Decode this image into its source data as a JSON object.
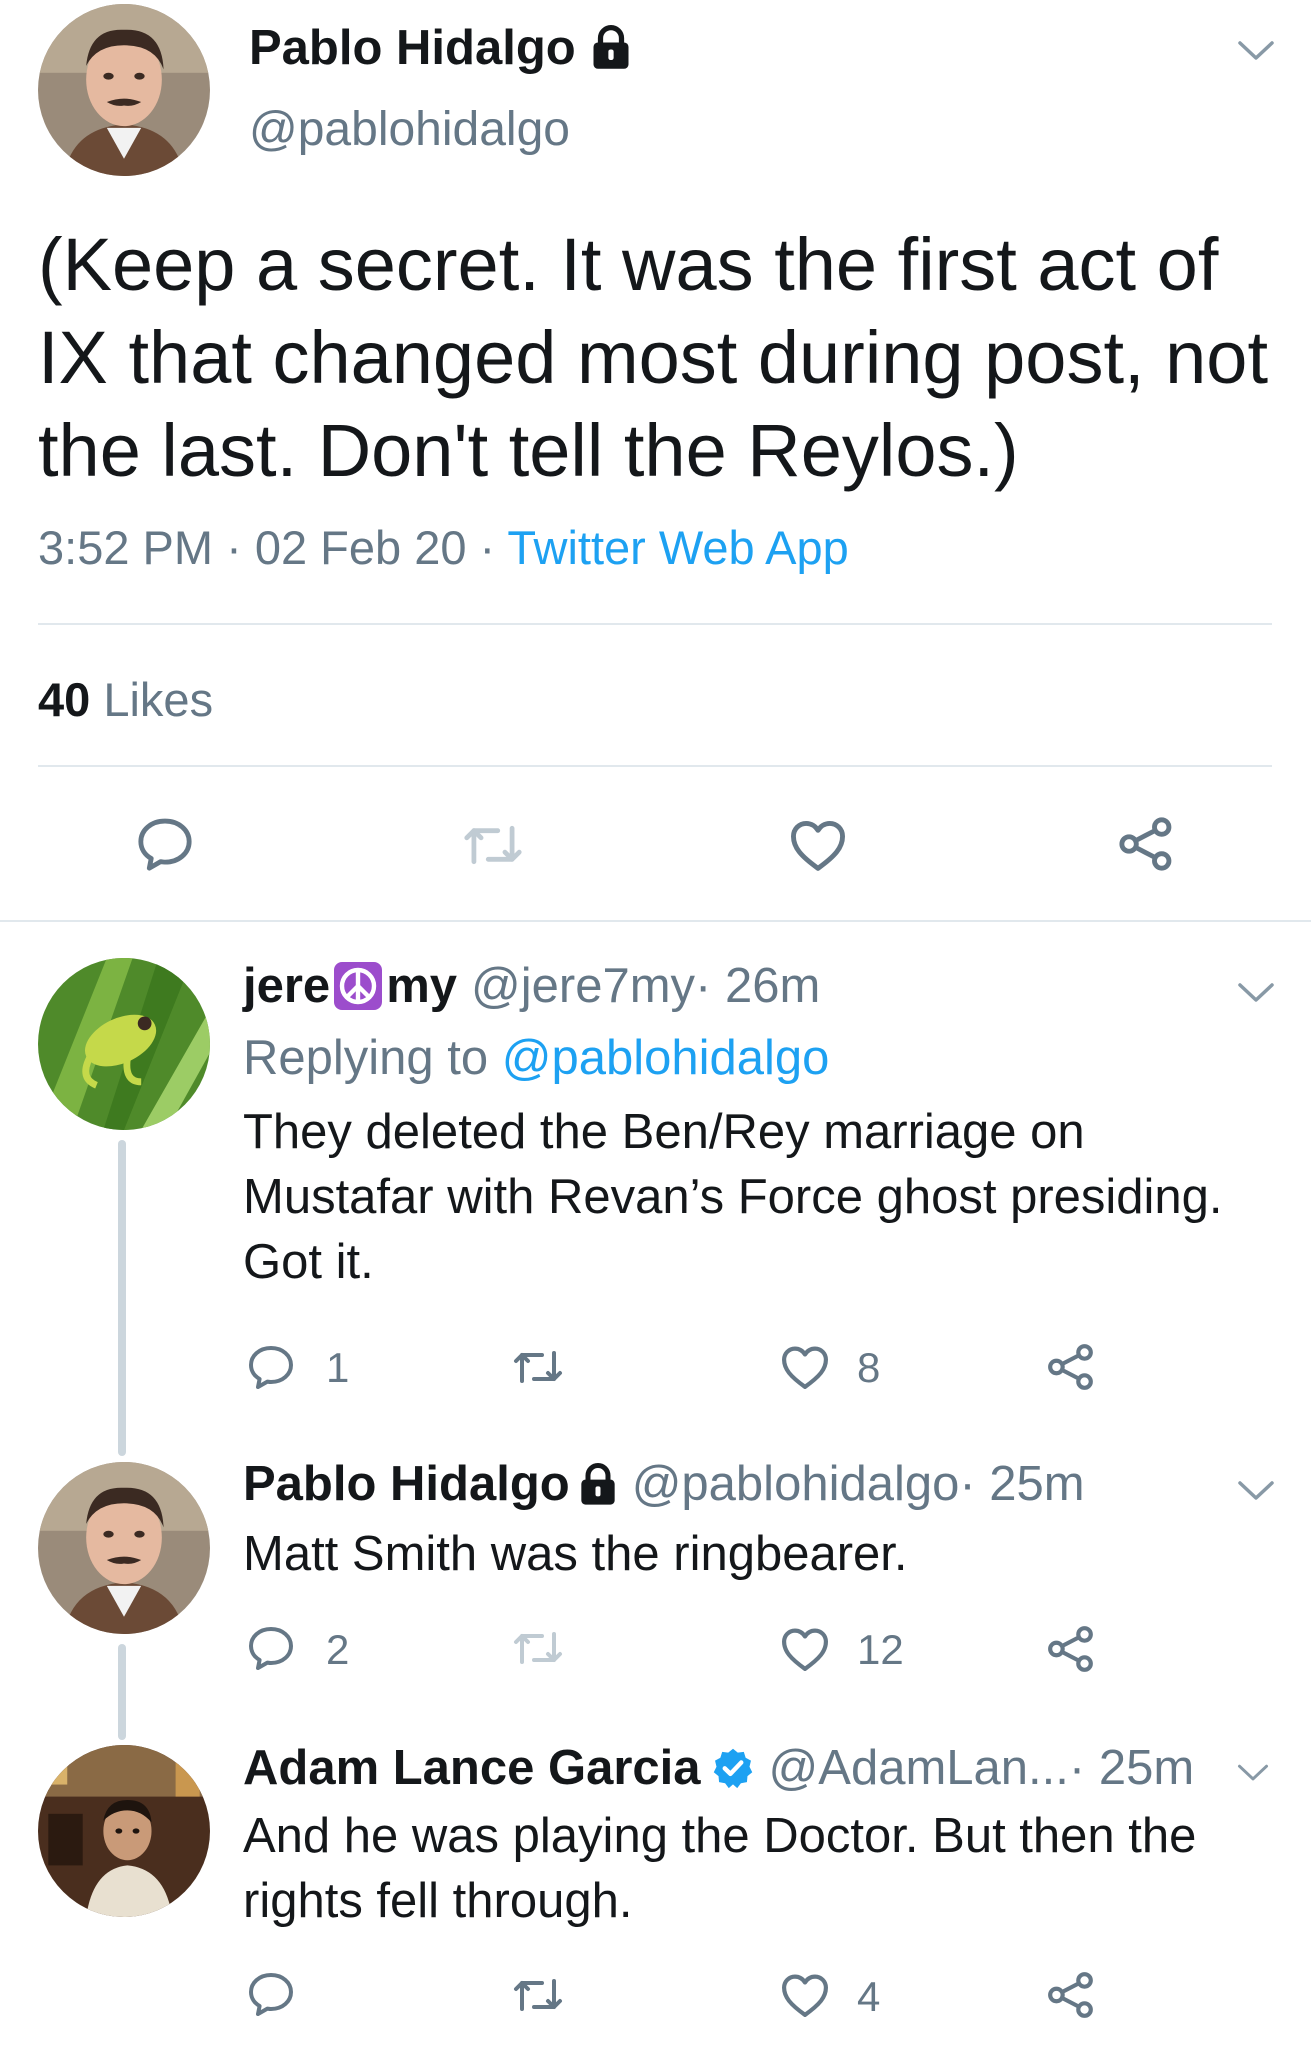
{
  "main_tweet": {
    "author_name": "Pablo Hidalgo",
    "author_handle": "@pablohidalgo",
    "text": "(Keep a secret. It was the first act of IX that changed most during post, not the last. Don't tell the Reylos.)",
    "time": "3:52 PM",
    "date": "02 Feb 20",
    "separator": " · ",
    "source": "Twitter Web App",
    "likes_count": "40",
    "likes_label": "Likes"
  },
  "replies": [
    {
      "name_part1": "jere",
      "name_part2": "my",
      "handle": "@jere7my",
      "time_suffix": " · 26m",
      "replying_prefix": "Replying to ",
      "replying_to": "@pablohidalgo",
      "text": "They deleted the Ben/Rey marriage on Mustafar with Revan’s Force ghost presiding. Got it.",
      "reply_count": "1",
      "like_count": "8"
    },
    {
      "name": "Pablo Hidalgo",
      "handle": "@pablohidalgo",
      "time_suffix": " · 25m",
      "text": "Matt Smith was the ringbearer.",
      "reply_count": "2",
      "like_count": "12"
    },
    {
      "name": "Adam Lance Garcia",
      "handle": "@AdamLan...",
      "time_suffix": " · 25m",
      "text": "And he was playing the Doctor. But then the rights fell through.",
      "like_count": "4"
    }
  ],
  "colors": {
    "text": "#14171a",
    "secondary": "#657786",
    "accent": "#1da1f2",
    "divider": "#e1e8ed",
    "icon": "#657786"
  },
  "icons": [
    "lock-icon",
    "chevron-down-icon",
    "reply-icon",
    "retweet-icon",
    "like-icon",
    "share-icon",
    "peace-icon",
    "verified-icon"
  ]
}
